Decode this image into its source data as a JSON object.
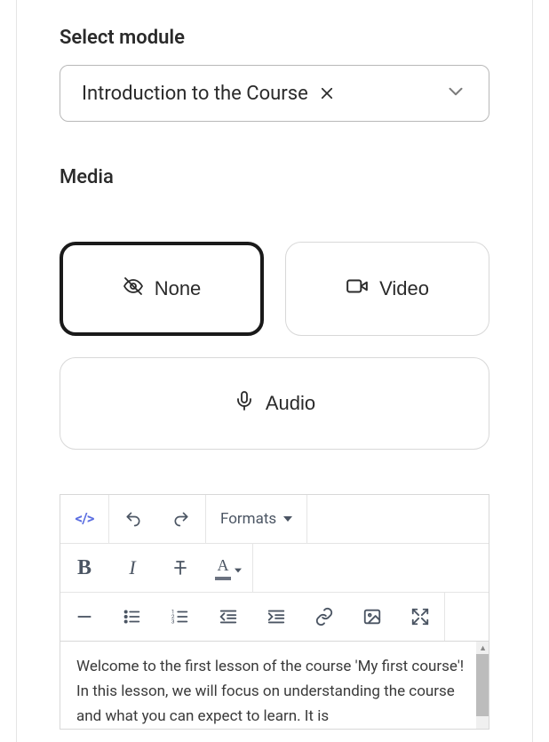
{
  "module": {
    "label": "Select module",
    "selected": "Introduction to the Course"
  },
  "media": {
    "label": "Media",
    "options": {
      "none": "None",
      "video": "Video",
      "audio": "Audio"
    }
  },
  "editor": {
    "formats_label": "Formats",
    "content": "Welcome to the first lesson of the course 'My first course'! In this lesson, we will focus on understanding the course and what you can expect to learn. It is"
  }
}
